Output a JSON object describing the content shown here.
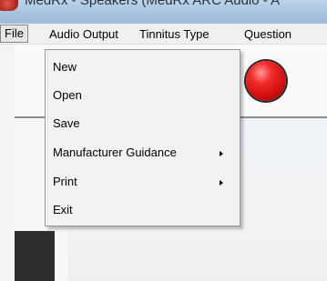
{
  "window": {
    "title": "MedRx - Speakers (MedRx ARC Audio - A"
  },
  "menubar": {
    "items": [
      {
        "label": "File"
      },
      {
        "label": "Audio Output"
      },
      {
        "label": "Tinnitus Type"
      },
      {
        "label": "Question"
      }
    ]
  },
  "file_menu": {
    "items": [
      {
        "label": "New",
        "has_submenu": false
      },
      {
        "label": "Open",
        "has_submenu": false
      },
      {
        "label": "Save",
        "has_submenu": false
      },
      {
        "label": "Manufacturer Guidance",
        "has_submenu": true
      },
      {
        "label": "Print",
        "has_submenu": true
      },
      {
        "label": "Exit",
        "has_submenu": false
      }
    ]
  },
  "colors": {
    "record_button": "#e01515",
    "menu_background": "#f2f2f2"
  },
  "icons": {
    "app": "medrx-app-icon",
    "record": "red-record-button",
    "submenu": "triangle-right"
  }
}
